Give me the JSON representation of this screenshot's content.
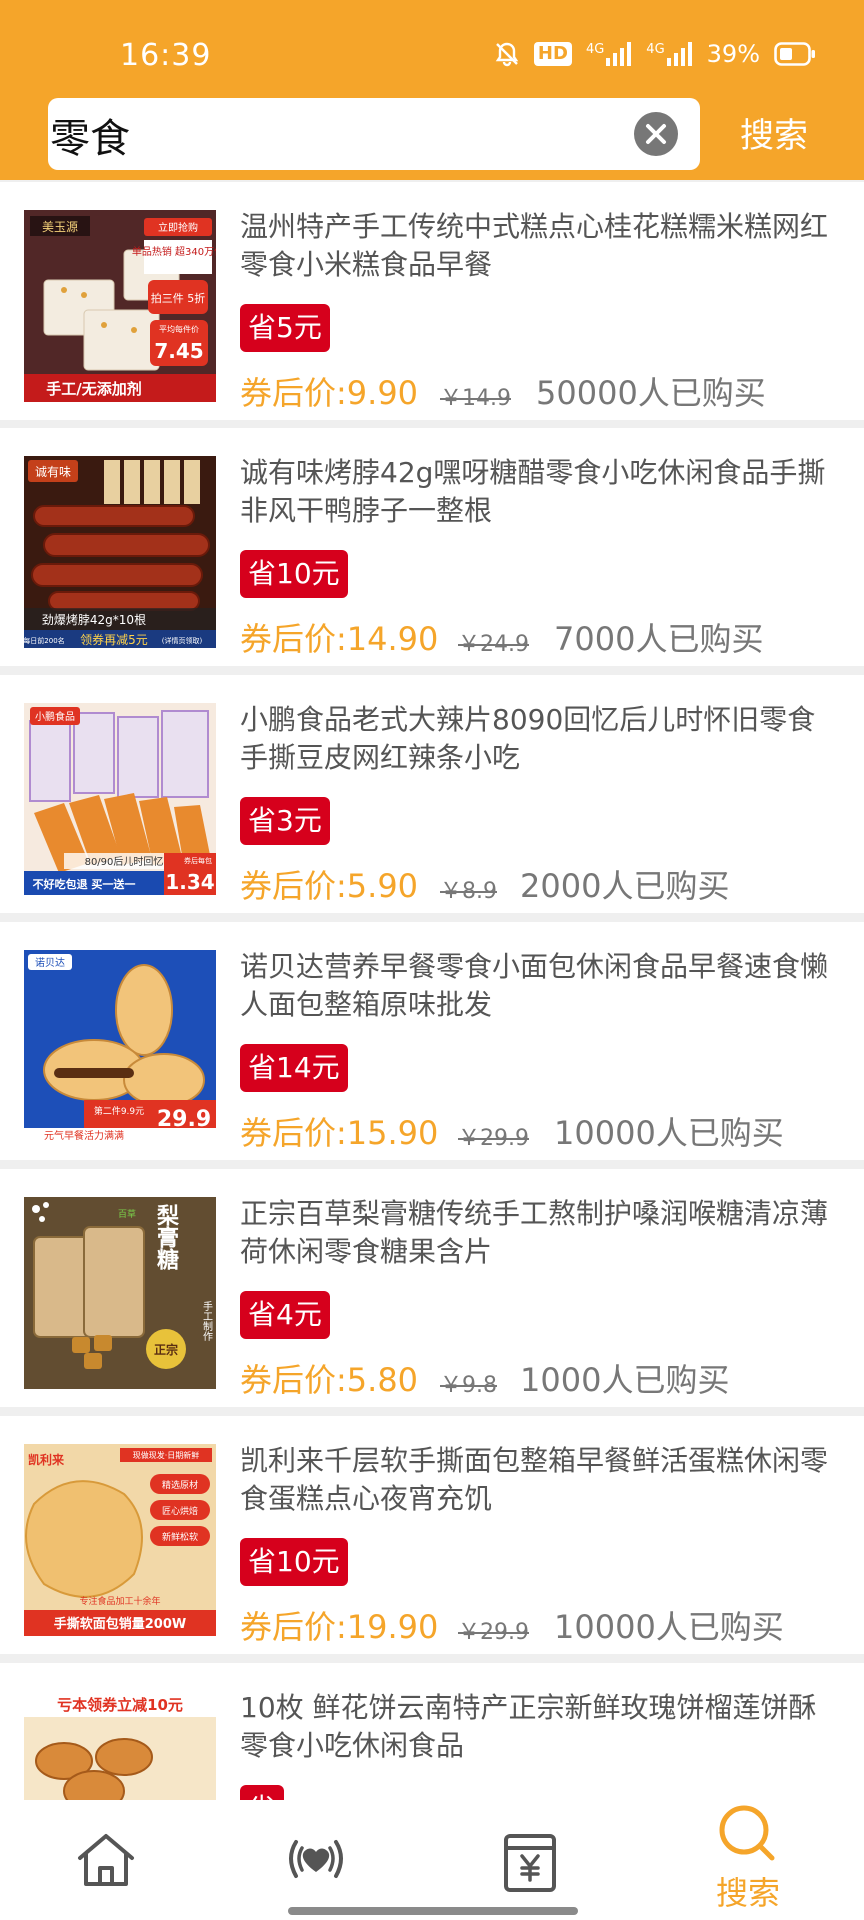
{
  "status_bar": {
    "time": "16:39",
    "battery_percent": "39%",
    "network_1": "4G",
    "network_2": "4G",
    "hd_label": "HD",
    "icons": [
      "mute-icon",
      "hd-icon",
      "signal-icon",
      "signal-icon",
      "battery-icon"
    ]
  },
  "search": {
    "query": "零食",
    "button_label": "搜索"
  },
  "colors": {
    "brand": "#f5a52a",
    "badge_red": "#d6001c",
    "text_gray": "#555555"
  },
  "products": [
    {
      "title": "温州特产手工传统中式糕点心桂花糕糯米糕网红零食小米糕食品早餐",
      "save_badge": "省5元",
      "coupon_price": "券后价:9.90",
      "original_price": "￥14.9",
      "sold": "50000人已购买",
      "thumb_text": [
        "美玉源",
        "立即抢购",
        "单品热销 超340万件",
        "拍三件 5折",
        "平均每件价",
        "7.45",
        "手工/无添加剂"
      ]
    },
    {
      "title": "诚有味烤脖42g嘿呀糖醋零食小吃休闲食品手撕非风干鸭脖子一整根",
      "save_badge": "省10元",
      "coupon_price": "券后价:14.90",
      "original_price": "￥24.9",
      "sold": "7000人已购买",
      "thumb_text": [
        "诚有味",
        "劲爆烤脖42g*10根",
        "每日前200名",
        "领券再减5元",
        "(详情页领取)"
      ]
    },
    {
      "title": "小鹏食品老式大辣片8090回忆后儿时怀旧零食手撕豆皮网红辣条小吃",
      "save_badge": "省3元",
      "coupon_price": "券后价:5.90",
      "original_price": "￥8.9",
      "sold": "2000人已购买",
      "thumb_text": [
        "小鹏食品",
        "80/90后儿时回忆",
        "不好吃包退 买一送一",
        "券后每包",
        "1.34"
      ]
    },
    {
      "title": "诺贝达营养早餐零食小面包休闲食品早餐速食懒人面包整箱原味批发",
      "save_badge": "省14元",
      "coupon_price": "券后价:15.90",
      "original_price": "￥29.9",
      "sold": "10000人已购买",
      "thumb_text": [
        "诺贝达",
        "第二件9.9元",
        "29.9",
        "元气早餐活力满满"
      ]
    },
    {
      "title": "正宗百草梨膏糖传统手工熬制护嗓润喉糖清凉薄荷休闲零食糖果含片",
      "save_badge": "省4元",
      "coupon_price": "券后价:5.80",
      "original_price": "￥9.8",
      "sold": "1000人已购买",
      "thumb_text": [
        "百草",
        "梨膏糖",
        "正宗",
        "手工制作"
      ]
    },
    {
      "title": "凯利来千层软手撕面包整箱早餐鲜活蛋糕休闲零食蛋糕点心夜宵充饥",
      "save_badge": "省10元",
      "coupon_price": "券后价:19.90",
      "original_price": "￥29.9",
      "sold": "10000人已购买",
      "thumb_text": [
        "凯利来",
        "现做现发·日期新鲜",
        "精选原材",
        "匠心烘焙",
        "新鲜松软",
        "专注食品加工十余年",
        "手撕软面包销量200W"
      ]
    },
    {
      "title": "10枚 鲜花饼云南特产正宗新鲜玫瑰饼榴莲饼酥零食小吃休闲食品",
      "save_badge": "省",
      "coupon_price": "",
      "original_price": "",
      "sold": "",
      "thumb_text": [
        "亏本领券立减10元"
      ]
    }
  ],
  "bottom_nav": [
    {
      "icon": "home-icon",
      "label": ""
    },
    {
      "icon": "live-heart-icon",
      "label": ""
    },
    {
      "icon": "coupon-yen-icon",
      "label": ""
    },
    {
      "icon": "search-icon",
      "label": "搜索",
      "active": true
    }
  ]
}
